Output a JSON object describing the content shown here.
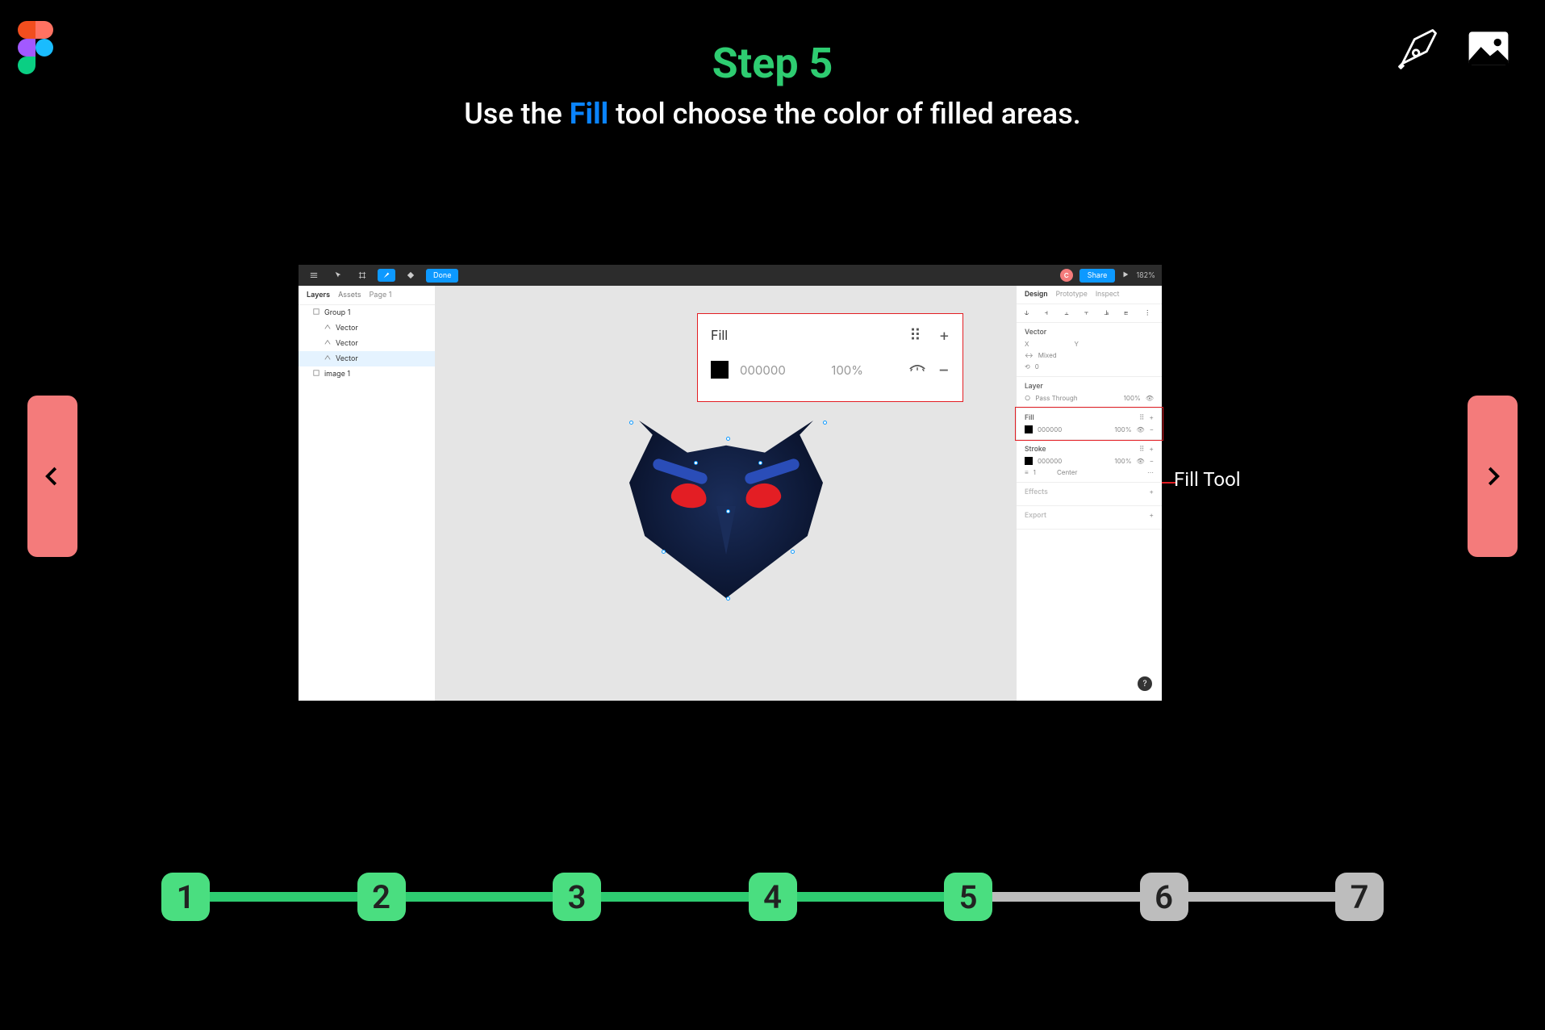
{
  "title": "Step 5",
  "subtitle_pre": "Use the ",
  "subtitle_highlight": "Fill",
  "subtitle_post": " tool choose the color of filled areas.",
  "fill_tool_label": "Fill Tool",
  "toolbar": {
    "done": "Done",
    "avatar": "C",
    "share": "Share",
    "zoom": "182%"
  },
  "layers_panel": {
    "tab_layers": "Layers",
    "tab_assets": "Assets",
    "page": "Page 1",
    "items": [
      {
        "label": "Group 1",
        "indent": false,
        "selected": false
      },
      {
        "label": "Vector",
        "indent": true,
        "selected": false
      },
      {
        "label": "Vector",
        "indent": true,
        "selected": false
      },
      {
        "label": "Vector",
        "indent": true,
        "selected": true
      },
      {
        "label": "image 1",
        "indent": false,
        "selected": false
      }
    ]
  },
  "design_panel": {
    "tab_design": "Design",
    "tab_prototype": "Prototype",
    "tab_inspect": "Inspect",
    "vector": {
      "title": "Vector",
      "x": "X",
      "y": "Y",
      "mixed": "Mixed",
      "angle": "0"
    },
    "layer": {
      "title": "Layer",
      "blend": "Pass Through",
      "opacity": "100%"
    },
    "fill": {
      "title": "Fill",
      "hex": "000000",
      "opacity": "100%"
    },
    "stroke": {
      "title": "Stroke",
      "hex": "000000",
      "opacity": "100%",
      "weight": "1",
      "align": "Center"
    },
    "effects": {
      "title": "Effects"
    },
    "export": {
      "title": "Export"
    }
  },
  "fill_callout": {
    "title": "Fill",
    "hex": "000000",
    "opacity": "100%"
  },
  "stepper": {
    "total": 7,
    "current": 5,
    "labels": [
      "1",
      "2",
      "3",
      "4",
      "5",
      "6",
      "7"
    ]
  }
}
